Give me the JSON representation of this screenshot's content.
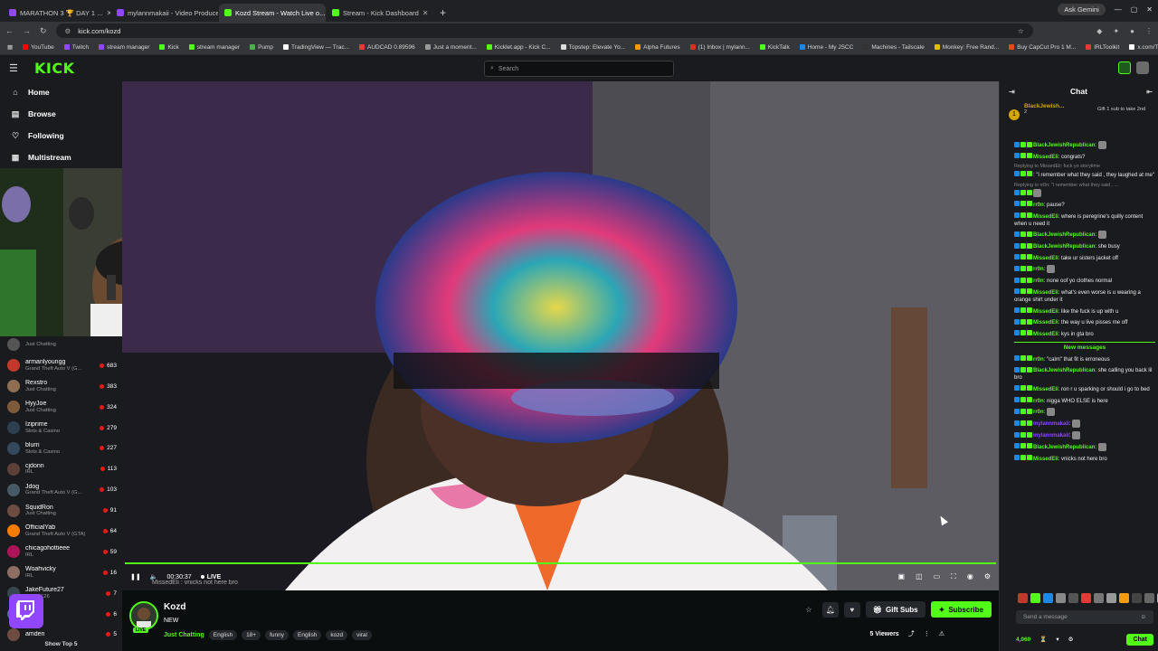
{
  "browser": {
    "tabs": [
      {
        "label": "MARATHON 3 🏆 DAY 1 ...",
        "color": "#9146ff",
        "active": false
      },
      {
        "label": "mylannmakaii - Video Producer",
        "color": "#9146ff",
        "active": false
      },
      {
        "label": "Kozd Stream - Watch Live o...",
        "color": "#53fc18",
        "active": true
      },
      {
        "label": "Stream - Kick Dashboard",
        "color": "#53fc18",
        "active": false
      }
    ],
    "new_tab": "+",
    "gemini": "Ask Gemini",
    "url": "kick.com/kozd",
    "bookmarks": [
      {
        "label": "YouTube",
        "color": "#ff0000"
      },
      {
        "label": "Twitch",
        "color": "#9146ff"
      },
      {
        "label": "stream manager",
        "color": "#9146ff"
      },
      {
        "label": "Kick",
        "color": "#53fc18"
      },
      {
        "label": "stream manager",
        "color": "#53fc18"
      },
      {
        "label": "Pump",
        "color": "#4caf50"
      },
      {
        "label": "TradingView — Trac...",
        "color": "#fff"
      },
      {
        "label": "AUDCAD 0.89596",
        "color": "#e53935"
      },
      {
        "label": "Just a moment...",
        "color": "#999"
      },
      {
        "label": "Kicklet.app - Kick C...",
        "color": "#53fc18"
      },
      {
        "label": "Topstep: Elevate Yo...",
        "color": "#ddd"
      },
      {
        "label": "Alpha Futures",
        "color": "#ff9800"
      },
      {
        "label": "(1) Inbox | mylann...",
        "color": "#d93025"
      },
      {
        "label": "KickTalk",
        "color": "#53fc18"
      },
      {
        "label": "Home - My JSCC",
        "color": "#1e88e5"
      },
      {
        "label": "Machines - Tailscale",
        "color": "#333"
      },
      {
        "label": "Monkey: Free Rand...",
        "color": "#e0c000"
      },
      {
        "label": "Buy CapCut Pro 1 M...",
        "color": "#e64a19"
      },
      {
        "label": "IRLToolkit",
        "color": "#e53935"
      },
      {
        "label": "x.com/Tangjsen",
        "color": "#fff"
      }
    ]
  },
  "header": {
    "logo": "KICK",
    "search_placeholder": "Search"
  },
  "sidebar": {
    "nav": [
      {
        "label": "Home",
        "icon": "home-icon",
        "glyph": "⌂"
      },
      {
        "label": "Browse",
        "icon": "browse-icon",
        "glyph": "▤"
      },
      {
        "label": "Following",
        "icon": "heart-icon",
        "glyph": "♡"
      },
      {
        "label": "Multistream",
        "icon": "multistream-icon",
        "glyph": "▦"
      }
    ],
    "channels": [
      {
        "name": "",
        "category": "Just Chatting",
        "viewers": "",
        "color": "#555"
      },
      {
        "name": "armanlyoungg",
        "category": "Grand Theft Auto V (G...",
        "viewers": "683",
        "color": "#c0392b"
      },
      {
        "name": "Rexstro",
        "category": "Just Chatting",
        "viewers": "383",
        "color": "#8e6e53"
      },
      {
        "name": "HyyJoe",
        "category": "Just Chatting",
        "viewers": "324",
        "color": "#7d5a3c"
      },
      {
        "name": "Iziprime",
        "category": "Slots & Casino",
        "viewers": "279",
        "color": "#2c3e50"
      },
      {
        "name": "blurri",
        "category": "Slots & Casino",
        "viewers": "227",
        "color": "#34495e"
      },
      {
        "name": "cjdonn",
        "category": "IRL",
        "viewers": "113",
        "color": "#5d4037"
      },
      {
        "name": "Jdog",
        "category": "Grand Theft Auto V (G...",
        "viewers": "103",
        "color": "#455a64"
      },
      {
        "name": "SquidRon",
        "category": "Just Chatting",
        "viewers": "91",
        "color": "#6d4c41"
      },
      {
        "name": "OfficialYab",
        "category": "Grand Theft Auto V (GTA)",
        "viewers": "64",
        "color": "#f57c00"
      },
      {
        "name": "chicagohottieee",
        "category": "IRL",
        "viewers": "59",
        "color": "#ad1457"
      },
      {
        "name": "Woahvicky",
        "category": "IRL",
        "viewers": "16",
        "color": "#8d6e63"
      },
      {
        "name": "JakeFuture27",
        "category": "NBA 2K26",
        "viewers": "7",
        "color": "#37474f"
      },
      {
        "name": "ef1zz",
        "category": "League",
        "viewers": "6",
        "color": "#546e7a"
      },
      {
        "name": "amden",
        "category": "",
        "viewers": "5",
        "color": "#6d4c41"
      }
    ],
    "show_top": "Show Top 5"
  },
  "player": {
    "time": "00:30:37",
    "live": "LIVE",
    "subtitle": "MissedEli : vnicks not here bro"
  },
  "stream": {
    "name": "Kozd",
    "title": "NEW",
    "live_badge": "LIVE",
    "category": "Just Chatting",
    "tags": [
      "English",
      "18+",
      "funny",
      "English",
      "kozd",
      "viral"
    ],
    "gift_subs": "Gift Subs",
    "subscribe": "Subscribe",
    "viewers": "5 Viewers"
  },
  "chat": {
    "title": "Chat",
    "pinned": {
      "name": "BlackJewish...",
      "count": "2",
      "text": "Gift 1 sub to take 2nd"
    },
    "messages": [
      {
        "user": "BlackJewishRepublican",
        "color": "#53fc18",
        "text": ""
      },
      {
        "user": "MissedEli",
        "color": "#53fc18",
        "text": "congrats?"
      },
      {
        "reply": "Replying to MissedEli: fuck yo storytime"
      },
      {
        "user": "",
        "color": "#53fc18",
        "text": ": \"i remember what they said , they laughed at me\""
      },
      {
        "reply": "Replying to rr0n: \"i remember what they said , ..."
      },
      {
        "user": "",
        "color": "#53fc18",
        "text": ""
      },
      {
        "user": "rr0n",
        "color": "#53fc18",
        "text": "pause?"
      },
      {
        "user": "MissedEli",
        "color": "#53fc18",
        "text": "where is peregrine's quilly content when u need it"
      },
      {
        "user": "BlackJewishRepublican",
        "color": "#53fc18",
        "text": ""
      },
      {
        "user": "BlackJewishRepublican",
        "color": "#53fc18",
        "text": "she busy"
      },
      {
        "user": "MissedEli",
        "color": "#53fc18",
        "text": "take ur sisters jacket off"
      },
      {
        "user": "rr0n",
        "color": "#53fc18",
        "text": ""
      },
      {
        "user": "rr0n",
        "color": "#53fc18",
        "text": "none oof yo clothes normal"
      },
      {
        "user": "MissedEli",
        "color": "#53fc18",
        "text": "what's even worse is u wearing a orange shirt under it"
      },
      {
        "user": "MissedEli",
        "color": "#53fc18",
        "text": "like the fuck is up with u"
      },
      {
        "user": "MissedEli",
        "color": "#53fc18",
        "text": "the way u live pisses me off"
      },
      {
        "user": "MissedEli",
        "color": "#53fc18",
        "text": "kys in gta bro"
      }
    ],
    "new_messages": "New messages",
    "messages2": [
      {
        "user": "rr0n",
        "color": "#53fc18",
        "text": "\"calm\" that fit is erroneous"
      },
      {
        "user": "BlackJewishRepublican",
        "color": "#53fc18",
        "text": "she calling you back lil bro"
      },
      {
        "user": "MissedEli",
        "color": "#53fc18",
        "text": "ron r u sparking or should i go to bed"
      },
      {
        "user": "rr0n",
        "color": "#53fc18",
        "text": "nigga WHO ELSE is here"
      },
      {
        "user": "rr0n",
        "color": "#53fc18",
        "text": ""
      },
      {
        "user": "mylannmakaii",
        "color": "#9146ff",
        "text": ""
      },
      {
        "user": "mylannmakaii",
        "color": "#9146ff",
        "text": ""
      },
      {
        "user": "BlackJewishRepublican",
        "color": "#53fc18",
        "text": ""
      },
      {
        "user": "MissedEli",
        "color": "#53fc18",
        "text": "vnicks not here bro"
      }
    ],
    "input_placeholder": "Send a message",
    "points": "4,060",
    "chat_button": "Chat"
  },
  "colors": {
    "accent": "#53fc18",
    "bg": "#0b0e0f",
    "panel": "#191b1f"
  }
}
